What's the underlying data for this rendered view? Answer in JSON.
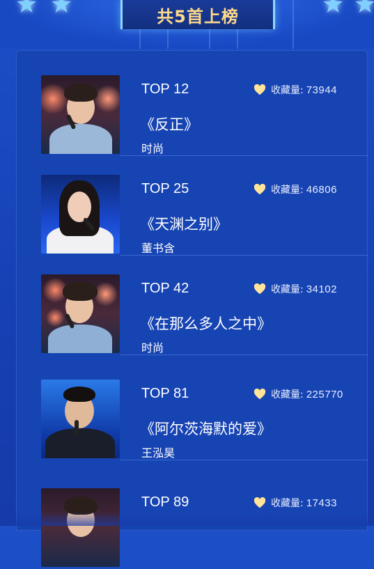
{
  "header": {
    "title": "共5首上榜"
  },
  "colors": {
    "background": "#1c4fc8",
    "panel": "#1744b3",
    "heart": "#ffe49a",
    "title": "#ffd98a"
  },
  "fav_label": "收藏量:",
  "entries": [
    {
      "rank": "TOP 12",
      "favorites": "73944",
      "song": "《反正》",
      "singer": "时尚"
    },
    {
      "rank": "TOP 25",
      "favorites": "46806",
      "song": "《天渊之别》",
      "singer": "董书含"
    },
    {
      "rank": "TOP 42",
      "favorites": "34102",
      "song": "《在那么多人之中》",
      "singer": "时尚"
    },
    {
      "rank": "TOP 81",
      "favorites": "225770",
      "song": "《阿尔茨海默的爱》",
      "singer": "王泓昊"
    },
    {
      "rank": "TOP 89",
      "favorites": "17433"
    }
  ]
}
